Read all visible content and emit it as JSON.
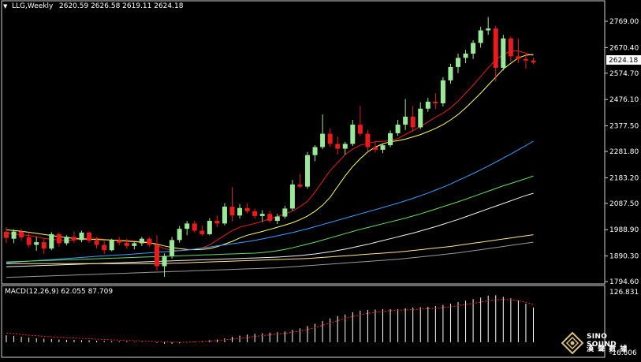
{
  "header": {
    "symbol": "LLG,Weekly",
    "ohlc": "2620.59 2626.58 2619.11 2624.18",
    "menu_glyph": "▼"
  },
  "macd": {
    "label": "MACD(12,26,9) 62.055 87.709",
    "axis_top": "126.831",
    "axis_bottom": "-16.606"
  },
  "logo": {
    "line1": "SINO SOUND",
    "line2": "漢 聲 數 據"
  },
  "colors": {
    "background": "#000000",
    "frame": "#cfcfcf",
    "bull": "#9be89b",
    "bear": "#e81c1c",
    "ma_fast": "#e81c1c",
    "ma_slow": "#ffff66",
    "ma_blue": "#3aa0ff",
    "ma_green": "#66dd66",
    "ma_white": "#f2f2f2",
    "ma_khaki": "#ffe88a",
    "ma_gray": "#9a9a9a",
    "macd_hist": "#ffffff",
    "macd_signal": "#ff2222",
    "price_box": "#ffffff"
  },
  "chart_data": {
    "type": "candlestick",
    "timeframe": "Weekly",
    "ylim": [
      1794.6,
      2769.0
    ],
    "y_ticks": [
      "2769.00",
      "2670.40",
      "2574.70",
      "2476.10",
      "2377.50",
      "2281.80",
      "2183.20",
      "2087.50",
      "1988.90",
      "1890.30",
      "1794.60"
    ],
    "current_price": "2624.18",
    "candles": [
      [
        1981,
        1998,
        1938,
        1958
      ],
      [
        1955,
        1990,
        1938,
        1982
      ],
      [
        1982,
        1992,
        1948,
        1960
      ],
      [
        1960,
        1980,
        1922,
        1932
      ],
      [
        1932,
        1962,
        1910,
        1942
      ],
      [
        1942,
        1955,
        1898,
        1918
      ],
      [
        1918,
        1980,
        1912,
        1972
      ],
      [
        1972,
        1978,
        1925,
        1938
      ],
      [
        1938,
        1968,
        1930,
        1962
      ],
      [
        1962,
        1982,
        1940,
        1950
      ],
      [
        1950,
        1985,
        1942,
        1978
      ],
      [
        1978,
        1982,
        1940,
        1948
      ],
      [
        1948,
        1962,
        1918,
        1932
      ],
      [
        1932,
        1948,
        1898,
        1912
      ],
      [
        1912,
        1955,
        1908,
        1948
      ],
      [
        1948,
        1962,
        1930,
        1940
      ],
      [
        1940,
        1955,
        1918,
        1928
      ],
      [
        1928,
        1945,
        1915,
        1938
      ],
      [
        1938,
        1962,
        1928,
        1955
      ],
      [
        1955,
        1960,
        1925,
        1932
      ],
      [
        1932,
        1968,
        1835,
        1852
      ],
      [
        1852,
        1900,
        1812,
        1890
      ],
      [
        1890,
        1962,
        1880,
        1950
      ],
      [
        1950,
        2003,
        1940,
        1992
      ],
      [
        1992,
        2022,
        1968,
        2012
      ],
      [
        2012,
        2022,
        1978,
        1985
      ],
      [
        1985,
        2005,
        1965,
        1972
      ],
      [
        1972,
        2032,
        1968,
        2022
      ],
      [
        2022,
        2042,
        1998,
        2012
      ],
      [
        2012,
        2088,
        2005,
        2075
      ],
      [
        2075,
        2148,
        2020,
        2042
      ],
      [
        2042,
        2085,
        2030,
        2070
      ],
      [
        2070,
        2088,
        2050,
        2058
      ],
      [
        2058,
        2068,
        2030,
        2040
      ],
      [
        2040,
        2062,
        2018,
        2048
      ],
      [
        2048,
        2060,
        2015,
        2022
      ],
      [
        2022,
        2048,
        2010,
        2038
      ],
      [
        2038,
        2078,
        2030,
        2068
      ],
      [
        2068,
        2175,
        2060,
        2158
      ],
      [
        2158,
        2198,
        2145,
        2150
      ],
      [
        2150,
        2280,
        2142,
        2268
      ],
      [
        2268,
        2305,
        2245,
        2298
      ],
      [
        2298,
        2420,
        2290,
        2348
      ],
      [
        2348,
        2368,
        2298,
        2310
      ],
      [
        2310,
        2338,
        2270,
        2292
      ],
      [
        2292,
        2318,
        2270,
        2310
      ],
      [
        2310,
        2400,
        2302,
        2382
      ],
      [
        2382,
        2452,
        2340,
        2348
      ],
      [
        2348,
        2362,
        2282,
        2298
      ],
      [
        2298,
        2320,
        2278,
        2288
      ],
      [
        2288,
        2312,
        2275,
        2305
      ],
      [
        2305,
        2360,
        2298,
        2350
      ],
      [
        2350,
        2400,
        2340,
        2382
      ],
      [
        2382,
        2478,
        2362,
        2412
      ],
      [
        2412,
        2452,
        2355,
        2372
      ],
      [
        2372,
        2465,
        2365,
        2442
      ],
      [
        2442,
        2482,
        2430,
        2468
      ],
      [
        2468,
        2500,
        2440,
        2462
      ],
      [
        2462,
        2560,
        2450,
        2548
      ],
      [
        2548,
        2610,
        2535,
        2598
      ],
      [
        2598,
        2648,
        2575,
        2632
      ],
      [
        2632,
        2662,
        2612,
        2648
      ],
      [
        2648,
        2698,
        2628,
        2688
      ],
      [
        2688,
        2748,
        2670,
        2735
      ],
      [
        2735,
        2785,
        2718,
        2742
      ],
      [
        2742,
        2752,
        2545,
        2595
      ],
      [
        2595,
        2718,
        2585,
        2705
      ],
      [
        2705,
        2712,
        2618,
        2638
      ],
      [
        2638,
        2705,
        2612,
        2628
      ],
      [
        2628,
        2650,
        2592,
        2622
      ],
      [
        2622,
        2632,
        2608,
        2615
      ]
    ],
    "moving_averages": [
      {
        "color": "ma_fast",
        "values": [
          1977,
          1973,
          1970,
          1967,
          1962,
          1956,
          1953,
          1950,
          1948,
          1950,
          1955,
          1958,
          1956,
          1952,
          1950,
          1949,
          1948,
          1946,
          1944,
          1943,
          1930,
          1918,
          1912,
          1910,
          1912,
          1915,
          1920,
          1932,
          1950,
          1968,
          1985,
          1998,
          2005,
          2012,
          2020,
          2030,
          2038,
          2048,
          2058,
          2075,
          2095,
          2130,
          2170,
          2210,
          2240,
          2270,
          2290,
          2305,
          2312,
          2318,
          2320,
          2322,
          2330,
          2345,
          2360,
          2375,
          2392,
          2410,
          2425,
          2445,
          2470,
          2500,
          2530,
          2562,
          2595,
          2625,
          2645,
          2658,
          2658,
          2650,
          2640
        ]
      },
      {
        "color": "ma_slow",
        "values": [
          1988,
          1986,
          1983,
          1979,
          1975,
          1971,
          1967,
          1963,
          1959,
          1956,
          1954,
          1953,
          1952,
          1951,
          1950,
          1948,
          1946,
          1944,
          1942,
          1940,
          1935,
          1928,
          1922,
          1918,
          1915,
          1914,
          1915,
          1918,
          1925,
          1935,
          1945,
          1958,
          1968,
          1975,
          1982,
          1990,
          1998,
          2006,
          2015,
          2026,
          2040,
          2058,
          2080,
          2110,
          2150,
          2190,
          2225,
          2255,
          2280,
          2298,
          2310,
          2318,
          2322,
          2328,
          2336,
          2345,
          2356,
          2368,
          2382,
          2400,
          2420,
          2445,
          2472,
          2500,
          2530,
          2560,
          2590,
          2612,
          2632,
          2642,
          2645
        ]
      },
      {
        "color": "ma_blue",
        "values": [
          1865,
          1867,
          1869,
          1871,
          1873,
          1875,
          1877,
          1879,
          1881,
          1883,
          1885,
          1887,
          1889,
          1891,
          1893,
          1894,
          1896,
          1898,
          1900,
          1902,
          1904,
          1906,
          1908,
          1910,
          1913,
          1916,
          1920,
          1924,
          1928,
          1932,
          1936,
          1940,
          1944,
          1949,
          1954,
          1960,
          1966,
          1972,
          1978,
          1985,
          1992,
          2000,
          2008,
          2016,
          2024,
          2032,
          2040,
          2048,
          2056,
          2064,
          2072,
          2080,
          2088,
          2097,
          2106,
          2116,
          2126,
          2137,
          2148,
          2160,
          2173,
          2186,
          2199,
          2213,
          2227,
          2242,
          2257,
          2272,
          2288,
          2304,
          2320
        ]
      },
      {
        "color": "ma_green",
        "values": [
          1868,
          1869,
          1870,
          1871,
          1872,
          1873,
          1874,
          1875,
          1876,
          1877,
          1878,
          1879,
          1880,
          1881,
          1882,
          1883,
          1884,
          1885,
          1886,
          1887,
          1888,
          1889,
          1890,
          1891,
          1892,
          1893,
          1894,
          1895,
          1896,
          1897,
          1898,
          1899,
          1900,
          1901,
          1903,
          1906,
          1910,
          1915,
          1921,
          1928,
          1935,
          1942,
          1950,
          1958,
          1966,
          1974,
          1982,
          1990,
          1997,
          2004,
          2011,
          2018,
          2025,
          2032,
          2040,
          2048,
          2057,
          2066,
          2075,
          2084,
          2093,
          2103,
          2113,
          2123,
          2133,
          2143,
          2153,
          2162,
          2171,
          2180,
          2190
        ]
      },
      {
        "color": "ma_white",
        "values": [
          1850,
          1851,
          1852,
          1853,
          1854,
          1855,
          1856,
          1857,
          1858,
          1859,
          1860,
          1861,
          1862,
          1863,
          1864,
          1865,
          1866,
          1867,
          1868,
          1869,
          1870,
          1871,
          1872,
          1873,
          1874,
          1875,
          1876,
          1877,
          1878,
          1879,
          1880,
          1881,
          1882,
          1883,
          1884,
          1885,
          1886,
          1888,
          1890,
          1892,
          1895,
          1898,
          1902,
          1906,
          1911,
          1916,
          1922,
          1928,
          1934,
          1941,
          1948,
          1955,
          1962,
          1969,
          1976,
          1984,
          1992,
          2000,
          2009,
          2018,
          2027,
          2037,
          2047,
          2057,
          2067,
          2077,
          2087,
          2097,
          2107,
          2117,
          2125
        ]
      },
      {
        "color": "ma_khaki",
        "values": [
          1862,
          1862,
          1862,
          1862,
          1862,
          1862,
          1862,
          1862,
          1862,
          1862,
          1862,
          1862,
          1862,
          1862,
          1862,
          1862,
          1862,
          1862,
          1862,
          1862,
          1862,
          1862,
          1863,
          1864,
          1865,
          1866,
          1867,
          1868,
          1869,
          1870,
          1871,
          1872,
          1873,
          1874,
          1875,
          1876,
          1877,
          1878,
          1879,
          1880,
          1881,
          1883,
          1885,
          1887,
          1889,
          1891,
          1893,
          1895,
          1897,
          1899,
          1901,
          1903,
          1905,
          1908,
          1911,
          1914,
          1917,
          1920,
          1923,
          1926,
          1930,
          1934,
          1938,
          1942,
          1946,
          1950,
          1954,
          1958,
          1962,
          1966,
          1970
        ]
      },
      {
        "color": "ma_gray",
        "values": [
          1810,
          1811,
          1812,
          1813,
          1814,
          1815,
          1816,
          1817,
          1818,
          1819,
          1820,
          1821,
          1822,
          1823,
          1824,
          1825,
          1826,
          1827,
          1828,
          1829,
          1830,
          1831,
          1832,
          1833,
          1834,
          1835,
          1836,
          1837,
          1838,
          1839,
          1840,
          1841,
          1842,
          1843,
          1844,
          1845,
          1846,
          1848,
          1850,
          1852,
          1854,
          1856,
          1858,
          1860,
          1862,
          1864,
          1866,
          1868,
          1870,
          1872,
          1874,
          1876,
          1878,
          1881,
          1884,
          1887,
          1890,
          1893,
          1896,
          1899,
          1902,
          1906,
          1910,
          1914,
          1918,
          1922,
          1926,
          1930,
          1934,
          1938,
          1942
        ]
      }
    ],
    "macd": {
      "ylim": [
        -16.606,
        126.831
      ],
      "histogram": [
        18,
        16,
        14,
        12,
        10,
        9,
        8,
        7,
        6,
        6,
        5,
        5,
        4,
        3,
        3,
        2,
        2,
        1,
        1,
        0,
        -2,
        -4,
        -4,
        -3,
        -1,
        1,
        3,
        5,
        7,
        10,
        14,
        17,
        20,
        22,
        23,
        25,
        26,
        28,
        32,
        36,
        42,
        48,
        55,
        62,
        68,
        72,
        78,
        82,
        84,
        85,
        86,
        86,
        86,
        88,
        90,
        91,
        92,
        94,
        97,
        100,
        104,
        108,
        112,
        116,
        121,
        122,
        118,
        114,
        108,
        100,
        90
      ],
      "signal": [
        24,
        22,
        20,
        18,
        17,
        15,
        14,
        13,
        12,
        11,
        10,
        9,
        8,
        7,
        6,
        5,
        4,
        4,
        3,
        3,
        2,
        1,
        0,
        0,
        0,
        1,
        2,
        3,
        4,
        6,
        8,
        10,
        12,
        15,
        17,
        19,
        21,
        23,
        26,
        29,
        33,
        38,
        44,
        50,
        56,
        62,
        67,
        71,
        75,
        78,
        80,
        82,
        83,
        84,
        85,
        86,
        87,
        88,
        90,
        92,
        95,
        98,
        101,
        104,
        108,
        110,
        111,
        110,
        108,
        104,
        98
      ]
    }
  }
}
